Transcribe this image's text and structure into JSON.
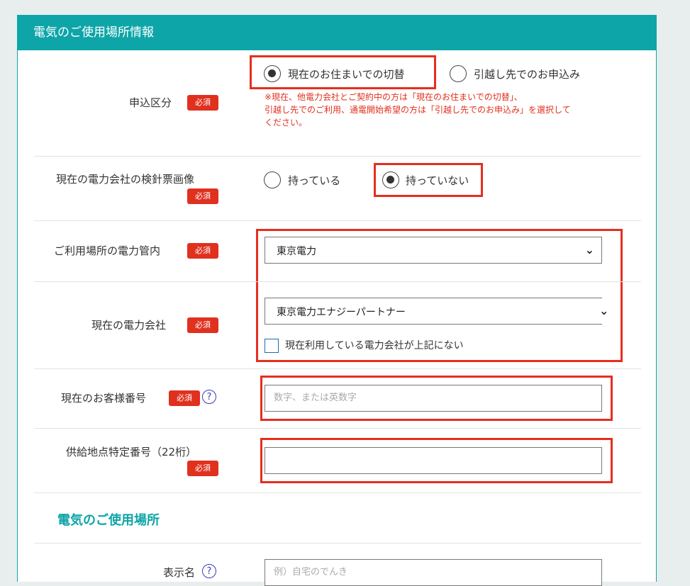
{
  "card": {
    "title": "電気のご使用場所情報"
  },
  "required_label": "必須",
  "help_mark": "?",
  "application_type": {
    "label": "申込区分",
    "options": [
      "現在のお住まいでの切替",
      "引越し先でのお申込み"
    ],
    "selected": 0,
    "note_lines": [
      "※現在、他電力会社とご契約中の方は「現在のお住まいでの切替」、",
      "引越し先でのご利用、通電開始希望の方は「引越し先でのお申込み」を選択して",
      "ください。"
    ]
  },
  "meter_slip": {
    "label": "現在の電力会社の検針票画像",
    "options": [
      "持っている",
      "持っていない"
    ],
    "selected": 1
  },
  "area": {
    "label": "ご利用場所の電力管内",
    "value": "東京電力"
  },
  "current_company": {
    "label": "現在の電力会社",
    "value": "東京電力エナジーパートナー",
    "checkbox_label": "現在利用している電力会社が上記にない"
  },
  "customer_number": {
    "label": "現在のお客様番号",
    "placeholder": "数字、または英数字"
  },
  "supply_point": {
    "label": "供給地点特定番号（22桁）",
    "placeholder": ""
  },
  "usage_place": {
    "section_title": "電気のご使用場所",
    "display_name_label": "表示名",
    "display_name_placeholder": "例）自宅のでんき"
  },
  "colors": {
    "accent": "#0ea5a8",
    "required": "#e0301e",
    "highlight": "#e62e1f"
  }
}
